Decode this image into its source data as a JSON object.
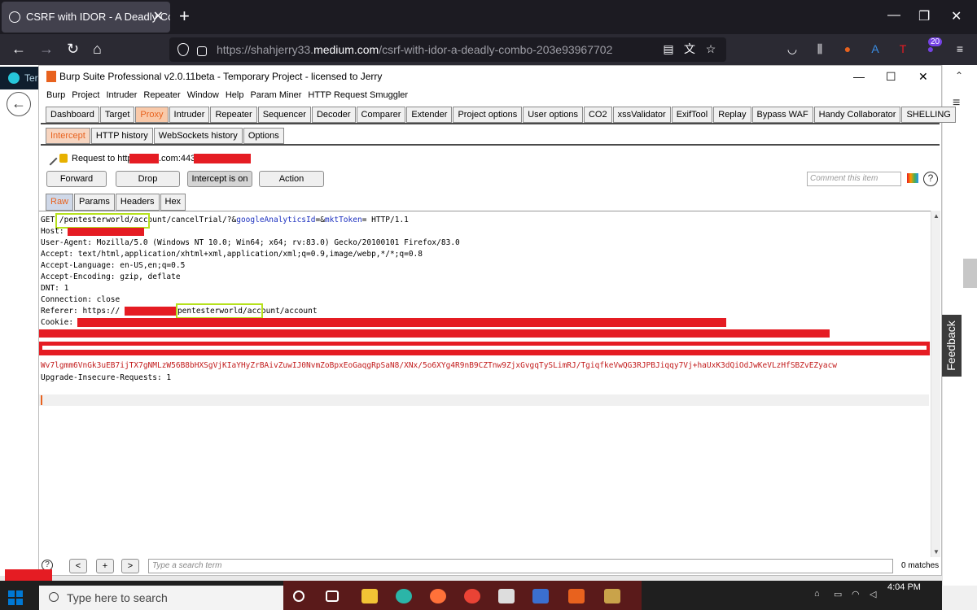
{
  "browser": {
    "tab_title": "CSRF with IDOR - A Deadly Con",
    "new_tab": "+",
    "url_scheme": "https://shahjerry33.",
    "url_host": "medium.com",
    "url_path": "/csrf-with-idor-a-deadly-combo-203e93967702",
    "badge": "20",
    "side_tab_label": "Ter"
  },
  "burp": {
    "title": "Burp Suite Professional v2.0.11beta - Temporary Project - licensed to Jerry",
    "menu": [
      "Burp",
      "Project",
      "Intruder",
      "Repeater",
      "Window",
      "Help",
      "Param Miner",
      "HTTP Request Smuggler"
    ],
    "main_tabs": [
      "Dashboard",
      "Target",
      "Proxy",
      "Intruder",
      "Repeater",
      "Sequencer",
      "Decoder",
      "Comparer",
      "Extender",
      "Project options",
      "User options",
      "CO2",
      "xssValidator",
      "ExifTool",
      "Replay",
      "Bypass WAF",
      "Handy Collaborator",
      "SHELLING"
    ],
    "proxy_tabs": [
      "Intercept",
      "HTTP history",
      "WebSockets history",
      "Options"
    ],
    "request_prefix": "Request to https:",
    "request_suffix": ".com:443",
    "buttons": {
      "forward": "Forward",
      "drop": "Drop",
      "intercept": "Intercept is on",
      "action": "Action"
    },
    "comment_placeholder": "Comment this item",
    "view_tabs": [
      "Raw",
      "Params",
      "Headers",
      "Hex"
    ],
    "search_placeholder": "Type a search term",
    "matches": "0 matches",
    "search_prev": "<",
    "search_add": "+",
    "search_next": ">",
    "help": "?"
  },
  "request": {
    "line1_method": "GET ",
    "line1_path": "/pentesterworld/account/cancelTrial/?&",
    "line1_param1": "googleAnalyticsId",
    "line1_mid": "=&",
    "line1_param2": "mktToken",
    "line1_end": "= HTTP/1.1",
    "host": "Host: ",
    "user_agent": "User-Agent: Mozilla/5.0 (Windows NT 10.0; Win64; x64; rv:83.0) Gecko/20100101 Firefox/83.0",
    "accept": "Accept: text/html,application/xhtml+xml,application/xml;q=0.9,image/webp,*/*;q=0.8",
    "accept_language": "Accept-Language: en-US,en;q=0.5",
    "accept_encoding": "Accept-Encoding: gzip, deflate",
    "dnt": "DNT: 1",
    "connection": "Connection: close",
    "referer_prefix": "Referer: https://",
    "referer_path": "/pentesterworld/account/account",
    "cookie": "Cookie: ",
    "cookie_tail": "Wv7lgmm6VnGk3uEB7ijTX7gNMLzW56B8bHXSgVjKIaYHyZrBAivZuwIJ0NvmZoBpxEoGaqgRpSaN8/XNx/5o6XYg4R9nB9CZTnw9ZjxGvgqTySLimRJ/TgiqfkeVwQG3RJPBJiqqy7Vj+haUxK3dQiOdJwKeVLzHfSBZvEZyacw",
    "upgrade": "Upgrade-Insecure-Requests: 1"
  },
  "page": {
    "feedback": "Feedback"
  },
  "taskbar": {
    "search": "Type here to search",
    "time": "4:04 PM"
  },
  "colors": {
    "burp_accent": "#e8621e",
    "redaction": "#e51c23",
    "highlight_box": "#b6e11e"
  }
}
